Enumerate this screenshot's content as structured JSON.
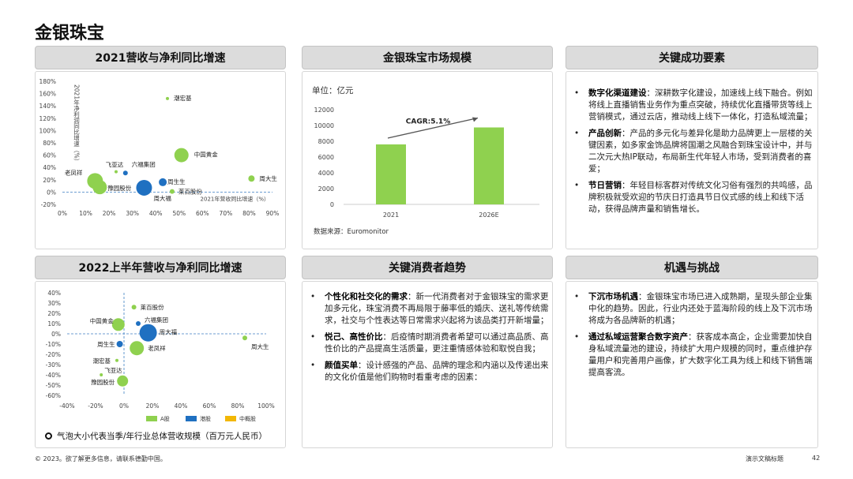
{
  "page_title": "金银珠宝",
  "panels": {
    "p1_title": "2021营收与净利同比增速",
    "p2_title": "金银珠宝市场规模",
    "p3_title": "关键成功要素",
    "p4_title": "2022上半年营收与净利同比增速",
    "p5_title": "关键消费者趋势",
    "p6_title": "机遇与挑战"
  },
  "market": {
    "unit_label": "单位：亿元",
    "cagr_label": "CAGR:5.1%",
    "source_label": "数据来源：Euromonitor"
  },
  "bubble_note": "气泡大小代表当季/年行业总体营收规模（百万元人民币）",
  "kfs": [
    {
      "bold": "数字化渠道建设",
      "text": "：深耕数字化建设，加速线上线下融合。例如将线上直播销售业务作为重点突破，持续优化直播带货等线上营销模式，通过云店，推动线上线下一体化，打造私域流量；"
    },
    {
      "bold": "产品创新",
      "text": "：产品的多元化与差异化是助力品牌更上一层楼的关键因素，如多家金饰品牌将国潮之风融合到珠宝设计中，并与二次元大热IP联动，布局新生代年轻人市场，受到消费者的喜爱；"
    },
    {
      "bold": "节日营销",
      "text": "：年轻目标客群对传统文化习俗有强烈的共鸣感，品牌积极就受欢迎的节庆日打造具节日仪式感的线上和线下活动，获得品牌声量和销售增长。"
    }
  ],
  "trends": [
    {
      "bold": "个性化和社交化的需求",
      "text": "：新一代消费者对于金银珠宝的需求更加多元化，珠宝消费不再局限于藤率低的婚庆、送礼等传统需求，社交与个性表达等日常需求兴起将为该品类打开新增量；"
    },
    {
      "bold": "悦己、高性价比",
      "text": "：后疫情时期消费者希望可以通过高品质、高性价比的产品提高生活质量，更注重情感体验和取悦自我；"
    },
    {
      "bold": "颜值买单",
      "text": "：设计感强的产品、品牌的理念和内涵以及传递出来的文化价值是他们购物时看重考虑的因素："
    }
  ],
  "opps": [
    {
      "bold": "下沉市场机遇",
      "text": "：金银珠宝市场已进入成熟期，呈现头部企业集中化的趋势。因此，行业内还处于蓝海阶段的线上及下沉市场将成为各品牌新的机遇；"
    },
    {
      "bold": "通过私域运营聚合数字资产",
      "text": "：获客成本高企，企业需要加快自身私域流量池的建设，持续扩大用户规模的同时，重点维护存量用户和完善用户画像，扩大数字化工具为线上和线下销售端提高客流。"
    }
  ],
  "footer": {
    "copyright": "© 2023。欲了解更多信息，请联系德勤中国。",
    "doc_title": "演示文稿标题",
    "page": "42"
  },
  "colors": {
    "green": "#8fd14f",
    "blue": "#1f70c1",
    "yellow": "#f2b705",
    "panel_head": "#dcdcdc"
  },
  "chart_data": [
    {
      "type": "scatter",
      "title": "2021营收与净利同比增速",
      "xlabel": "2021年营收同比增速（%）",
      "ylabel": "2021年净利润同比增速（%）",
      "xlim": [
        0,
        90
      ],
      "ylim": [
        -20,
        180
      ],
      "xticks": [
        "0%",
        "10%",
        "20%",
        "30%",
        "40%",
        "50%",
        "60%",
        "70%",
        "80%",
        "90%"
      ],
      "yticks": [
        "180%",
        "160%",
        "140%",
        "120%",
        "100%",
        "80%",
        "60%",
        "40%",
        "20%",
        "0%",
        "-20%"
      ],
      "points": [
        {
          "name": "潮宏基",
          "x": 45,
          "y": 152,
          "size": 2,
          "color": "#8fd14f"
        },
        {
          "name": "中国黄金",
          "x": 51,
          "y": 60,
          "size": 9,
          "color": "#8fd14f"
        },
        {
          "name": "飞亚达",
          "x": 23,
          "y": 33,
          "size": 2,
          "color": "#8fd14f"
        },
        {
          "name": "六福集团",
          "x": 27,
          "y": 31,
          "size": 3,
          "color": "#1f70c1"
        },
        {
          "name": "老凤祥",
          "x": 14,
          "y": 18,
          "size": 10,
          "color": "#8fd14f"
        },
        {
          "name": "豫园股份",
          "x": 16,
          "y": 8,
          "size": 9,
          "color": "#8fd14f"
        },
        {
          "name": "周大福",
          "x": 35,
          "y": 7,
          "size": 10,
          "color": "#1f70c1"
        },
        {
          "name": "周生生",
          "x": 43,
          "y": 16,
          "size": 5,
          "color": "#1f70c1"
        },
        {
          "name": "莱百股份",
          "x": 47,
          "y": 1,
          "size": 3,
          "color": "#8fd14f"
        },
        {
          "name": "周大生",
          "x": 81,
          "y": 22,
          "size": 4,
          "color": "#8fd14f"
        }
      ]
    },
    {
      "type": "bar",
      "title": "金银珠宝市场规模",
      "categories": [
        "2021",
        "2026E"
      ],
      "values": [
        7600,
        9750
      ],
      "ylim": [
        0,
        12000
      ],
      "yticks": [
        "12000",
        "10000",
        "8000",
        "6000",
        "4000",
        "2000",
        "0"
      ],
      "annotation": "CAGR:5.1%",
      "color": "#8fd14f"
    },
    {
      "type": "scatter",
      "title": "2022上半年营收与净利同比增速",
      "xlim": [
        -40,
        100
      ],
      "ylim": [
        -60,
        40
      ],
      "xticks": [
        "-40%",
        "-20%",
        "0%",
        "20%",
        "40%",
        "60%",
        "80%",
        "100%"
      ],
      "yticks": [
        "40%",
        "30%",
        "20%",
        "10%",
        "0%",
        "-10%",
        "-20%",
        "-30%",
        "-40%",
        "-50%",
        "-60%"
      ],
      "legend": [
        "A股",
        "港股",
        "中概股"
      ],
      "points": [
        {
          "name": "莱百股份",
          "x": 7,
          "y": 26,
          "size": 3,
          "color": "#8fd14f",
          "market": "A股"
        },
        {
          "name": "六福集团",
          "x": 10,
          "y": 10,
          "size": 3,
          "color": "#1f70c1",
          "market": "港股"
        },
        {
          "name": "中国黄金",
          "x": -4,
          "y": 9,
          "size": 8,
          "color": "#8fd14f",
          "market": "A股"
        },
        {
          "name": "周大福",
          "x": 17,
          "y": 1,
          "size": 11,
          "color": "#1f70c1",
          "market": "港股"
        },
        {
          "name": "周生生",
          "x": -3,
          "y": -10,
          "size": 4,
          "color": "#1f70c1",
          "market": "港股"
        },
        {
          "name": "老凤祥",
          "x": 9,
          "y": -14,
          "size": 9,
          "color": "#8fd14f",
          "market": "A股"
        },
        {
          "name": "周大生",
          "x": 85,
          "y": -4,
          "size": 3,
          "color": "#8fd14f",
          "market": "A股"
        },
        {
          "name": "潮宏基",
          "x": -5,
          "y": -26,
          "size": 2,
          "color": "#8fd14f",
          "market": "A股"
        },
        {
          "name": "飞亚达",
          "x": -16,
          "y": -40,
          "size": 2,
          "color": "#8fd14f",
          "market": "A股"
        },
        {
          "name": "豫园股份",
          "x": -1,
          "y": -46,
          "size": 7,
          "color": "#8fd14f",
          "market": "A股"
        }
      ]
    }
  ]
}
